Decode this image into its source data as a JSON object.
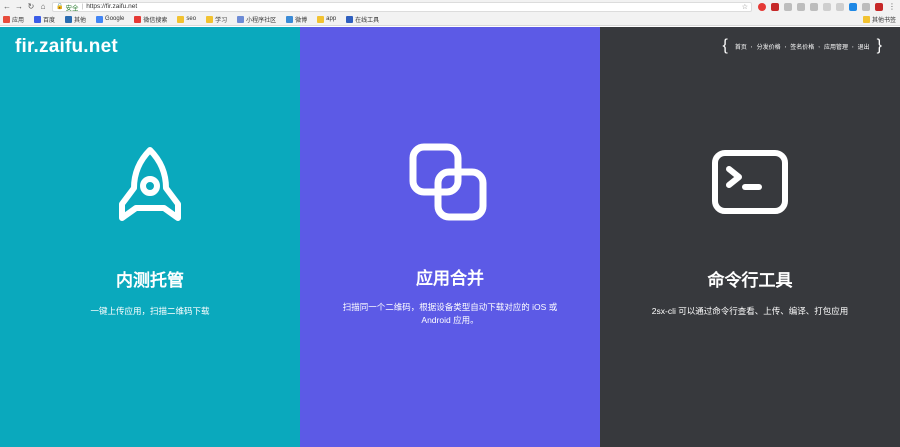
{
  "browser": {
    "secure_label": "安全",
    "url": "https://fir.zaifu.net"
  },
  "bookmarks": [
    {
      "label": "应用",
      "color": "#e74c3c"
    },
    {
      "label": "百度",
      "color": "#3b5de7"
    },
    {
      "label": "其他",
      "color": "#2b6cb0"
    },
    {
      "label": "Google",
      "color": "#4285f4"
    },
    {
      "label": "微信搜索",
      "color": "#e53935"
    },
    {
      "label": "seo",
      "color": "#f2c230"
    },
    {
      "label": "学习",
      "color": "#f2c230"
    },
    {
      "label": "小程序社区",
      "color": "#6d8bd6"
    },
    {
      "label": "微博",
      "color": "#3b8bd6"
    },
    {
      "label": "app",
      "color": "#f2c230"
    },
    {
      "label": "在线工具",
      "color": "#2f5fbf"
    }
  ],
  "other_bookmarks": "其他书签",
  "site": {
    "logo": "fir.zaifu.net",
    "nav": [
      "首页",
      "分发价格",
      "签名价格",
      "应用管理",
      "退出"
    ]
  },
  "features": [
    {
      "icon": "rocket-icon",
      "title": "内测托管",
      "desc": "一键上传应用，扫描二维码下载",
      "bg": "#0aa9bd"
    },
    {
      "icon": "merge-squares-icon",
      "title": "应用合并",
      "desc": "扫描同一个二维码，根据设备类型自动下载对应的 iOS 或 Android 应用。",
      "bg": "#5c5ae6"
    },
    {
      "icon": "terminal-icon",
      "title": "命令行工具",
      "desc": "2sx-cli 可以通过命令行查看、上传、编译、打包应用",
      "bg": "#37393d"
    }
  ]
}
